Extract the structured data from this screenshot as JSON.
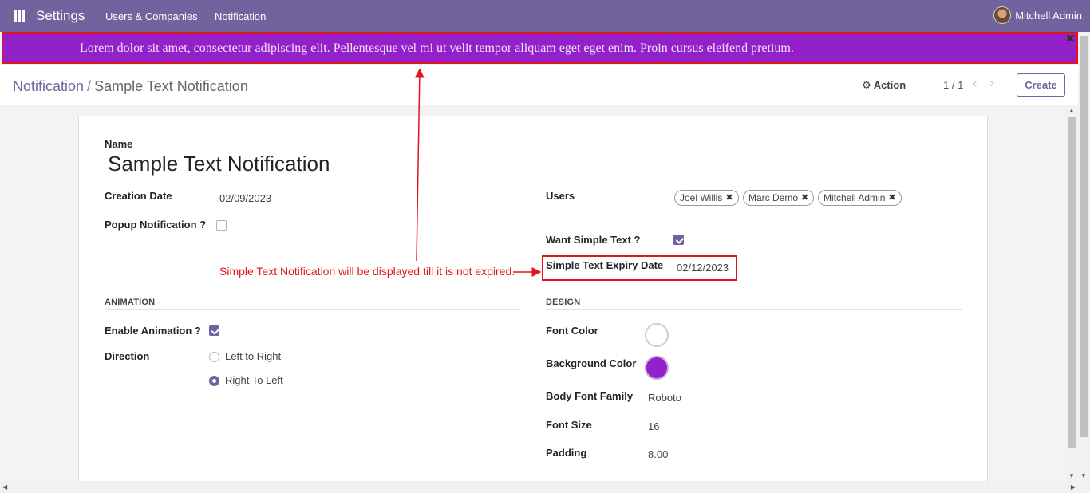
{
  "navbar": {
    "brand": "Settings",
    "links": [
      "Users & Companies",
      "Notification"
    ],
    "user_name": "Mitchell Admin"
  },
  "banner": {
    "text": "Lorem dolor sit amet, consectetur adipiscing elit. Pellentesque vel mi ut velit tempor aliquam eget eget enim. Proin cursus eleifend pretium.",
    "close_icon": "close-icon",
    "background": "#9420c9"
  },
  "control_panel": {
    "breadcrumb_parent": "Notification",
    "breadcrumb_separator": "/",
    "breadcrumb_current": "Sample Text Notification",
    "action_label": "Action",
    "pager": "1 / 1",
    "create_label": "Create"
  },
  "form": {
    "name_label": "Name",
    "name_value": "Sample Text Notification",
    "creation_date_label": "Creation Date",
    "creation_date_value": "02/09/2023",
    "popup_label": "Popup Notification ?",
    "popup_checked": false,
    "users_label": "Users",
    "users": [
      "Joel Willis",
      "Marc Demo",
      "Mitchell Admin"
    ],
    "want_simple_text_label": "Want Simple Text ?",
    "want_simple_text_checked": true,
    "expiry_label": "Simple Text Expiry Date",
    "expiry_value": "02/12/2023",
    "animation_section": "ANIMATION",
    "enable_animation_label": "Enable Animation ?",
    "enable_animation_checked": true,
    "direction_label": "Direction",
    "direction_options": [
      "Left to Right",
      "Right To Left"
    ],
    "direction_selected": "Right To Left",
    "design_section": "DESIGN",
    "font_color_label": "Font Color",
    "font_color": "#ffffff",
    "bg_color_label": "Background Color",
    "bg_color": "#9420c9",
    "body_font_label": "Body Font Family",
    "body_font_value": "Roboto",
    "font_size_label": "Font Size",
    "font_size_value": "16",
    "padding_label": "Padding",
    "padding_value": "8.00"
  },
  "annotation": {
    "text": "Simple Text Notification will be displayed till it is not expired.",
    "color": "#e0161e"
  },
  "colors": {
    "navbar": "#71639e",
    "accent": "#71639e"
  }
}
